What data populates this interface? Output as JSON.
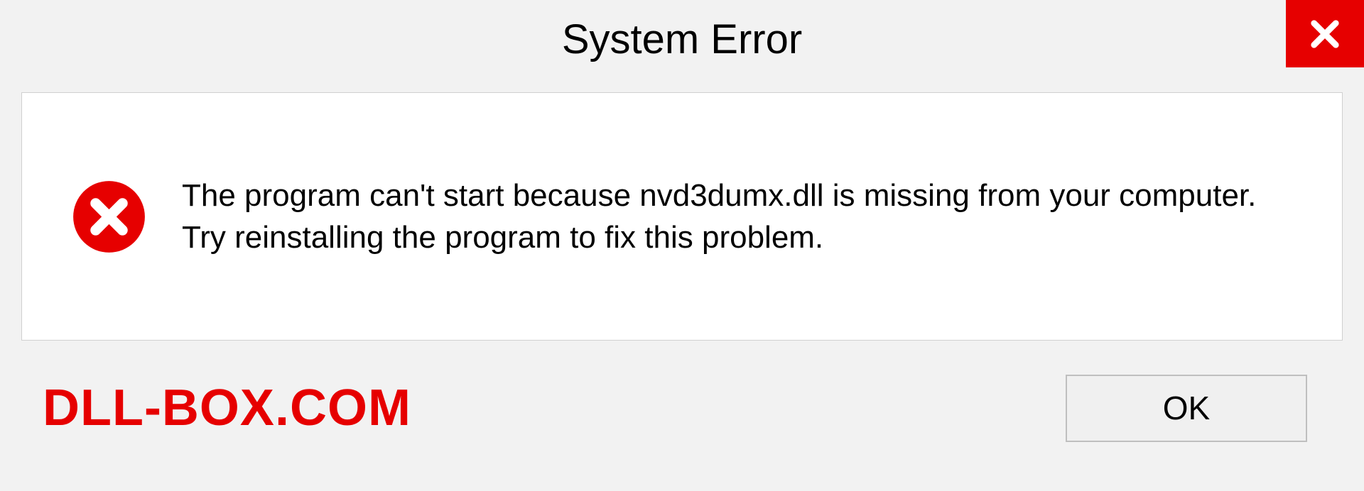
{
  "title": "System Error",
  "message": "The program can't start because nvd3dumx.dll is missing from your computer. Try reinstalling the program to fix this problem.",
  "watermark": "DLL-BOX.COM",
  "buttons": {
    "ok": "OK"
  },
  "colors": {
    "accent_red": "#e60000",
    "background": "#f2f2f2"
  }
}
